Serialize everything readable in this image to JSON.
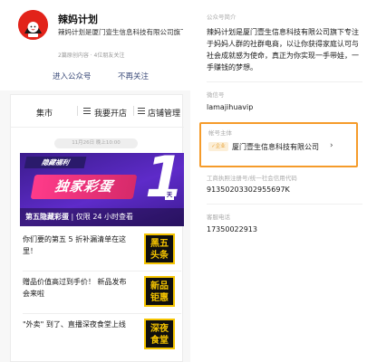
{
  "profile": {
    "name": "辣妈计划",
    "intro": "辣妈计划是厦门壹生信息科技有限公司旗下专注于妈妈人群的社群电商，以让...",
    "meta": "2篇原创内容 · 4位朋友关注",
    "enter_button": "进入公众号",
    "unfollow_button": "不再关注"
  },
  "menu": {
    "items": [
      "集市",
      "我要开店",
      "店铺管理"
    ]
  },
  "feed": {
    "timestamp": "11月26日 晚上10:00",
    "banner": {
      "tag": "隐藏福利",
      "headline": "独家彩蛋",
      "big_number": "1",
      "day": "天",
      "caption_bold": "第五隐藏彩蛋",
      "caption_rest": "| 仅限 24 小时查看"
    },
    "articles": [
      {
        "title": "你们要的第五 5 折补漏清单在这里！",
        "thumb": "黑五\n头条"
      },
      {
        "title": "赠品价值高过到手价！ 新品发布会来啦",
        "thumb": "新品\n钜惠"
      },
      {
        "title": "\"外卖\" 到了、直播深夜食堂上线",
        "thumb": "深夜\n食堂"
      }
    ]
  },
  "details": {
    "intro_label": "公众号简介",
    "intro": "辣妈计划是厦门壹生信息科技有限公司旗下专注于妈妈人群的社群电商，以让你获得家庭认可与社会成就感为使命，真正为你实现一手带娃，一手赚钱的梦想。",
    "wechat_label": "微信号",
    "wechat": "lamajihuavip",
    "subject_label": "帐号主体",
    "verified": "✓企业",
    "subject": "厦门壹生信息科技有限公司",
    "chevron": "›",
    "license_label": "工商执照注册号/统一社会信用代码",
    "license": "91350203302955697K",
    "phone_label": "客服电话",
    "phone": "17350022913"
  },
  "colors": {
    "brand_red": "#e2231a",
    "highlight_border": "#f59b2a",
    "banner_purple": "#3b1c8c",
    "banner_pink": "#ff3b8a",
    "thumb_yellow": "#f5c400"
  }
}
